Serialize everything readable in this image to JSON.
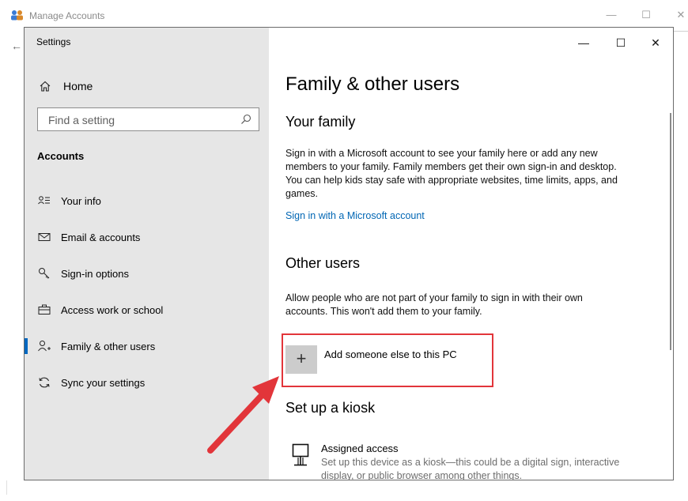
{
  "background_window": {
    "title": "Manage Accounts",
    "controls": {
      "minimize": "—",
      "maximize": "☐",
      "close": "✕"
    },
    "back_glyph": "←"
  },
  "window": {
    "title": "Settings",
    "controls": {
      "minimize": "—",
      "maximize": "☐",
      "close": "✕"
    }
  },
  "sidebar": {
    "home_label": "Home",
    "search_placeholder": "Find a setting",
    "section_header": "Accounts",
    "items": [
      {
        "label": "Your info",
        "icon": "person-list-icon",
        "selected": false
      },
      {
        "label": "Email & accounts",
        "icon": "envelope-icon",
        "selected": false
      },
      {
        "label": "Sign-in options",
        "icon": "key-icon",
        "selected": false
      },
      {
        "label": "Access work or school",
        "icon": "briefcase-icon",
        "selected": false
      },
      {
        "label": "Family & other users",
        "icon": "person-add-icon",
        "selected": true
      },
      {
        "label": "Sync your settings",
        "icon": "sync-icon",
        "selected": false
      }
    ]
  },
  "main": {
    "page_title": "Family & other users",
    "your_family": {
      "heading": "Your family",
      "description": "Sign in with a Microsoft account to see your family here or add any new members to your family. Family members get their own sign-in and desktop. You can help kids stay safe with appropriate websites, time limits, apps, and games.",
      "link": "Sign in with a Microsoft account"
    },
    "other_users": {
      "heading": "Other users",
      "description": "Allow people who are not part of your family to sign in with their own accounts. This won't add them to your family.",
      "add_button_label": "Add someone else to this PC",
      "add_glyph": "+"
    },
    "kiosk": {
      "heading": "Set up a kiosk",
      "item_title": "Assigned access",
      "item_description": "Set up this device as a kiosk—this could be a digital sign, interactive display, or public browser among other things."
    }
  },
  "colors": {
    "accent": "#0067c0",
    "link": "#0066b4",
    "annotation": "#e2353a",
    "sidebar_bg": "#e6e6e6"
  }
}
